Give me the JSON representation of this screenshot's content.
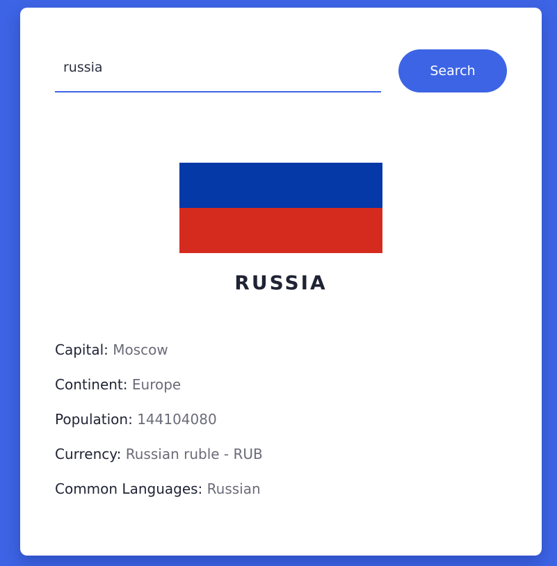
{
  "search": {
    "value": "russia",
    "button_label": "Search"
  },
  "country": {
    "name": "RUSSIA",
    "flag_colors": {
      "top": "#0539a8",
      "bottom": "#d52b1e"
    }
  },
  "details": [
    {
      "label": "Capital:",
      "value": "Moscow"
    },
    {
      "label": "Continent:",
      "value": "Europe"
    },
    {
      "label": "Population:",
      "value": "144104080"
    },
    {
      "label": "Currency:",
      "value": "Russian ruble - RUB"
    },
    {
      "label": "Common Languages:",
      "value": "Russian"
    }
  ],
  "colors": {
    "background": "#3d64e4",
    "accent": "#3d64e4",
    "card": "#ffffff"
  }
}
